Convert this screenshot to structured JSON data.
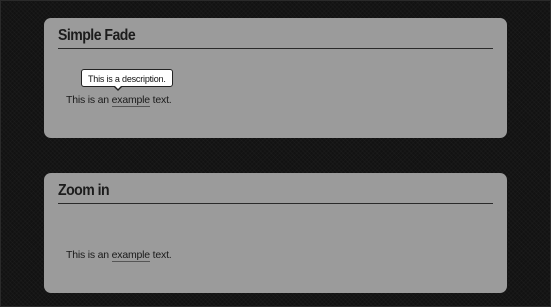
{
  "panels": [
    {
      "title": "Simple Fade",
      "text_before": "This is an ",
      "link_text": "example",
      "text_after": " text.",
      "tooltip": "This is a description."
    },
    {
      "title": "Zoom in",
      "text_before": "This is an ",
      "link_text": "example",
      "text_after": " text."
    }
  ]
}
